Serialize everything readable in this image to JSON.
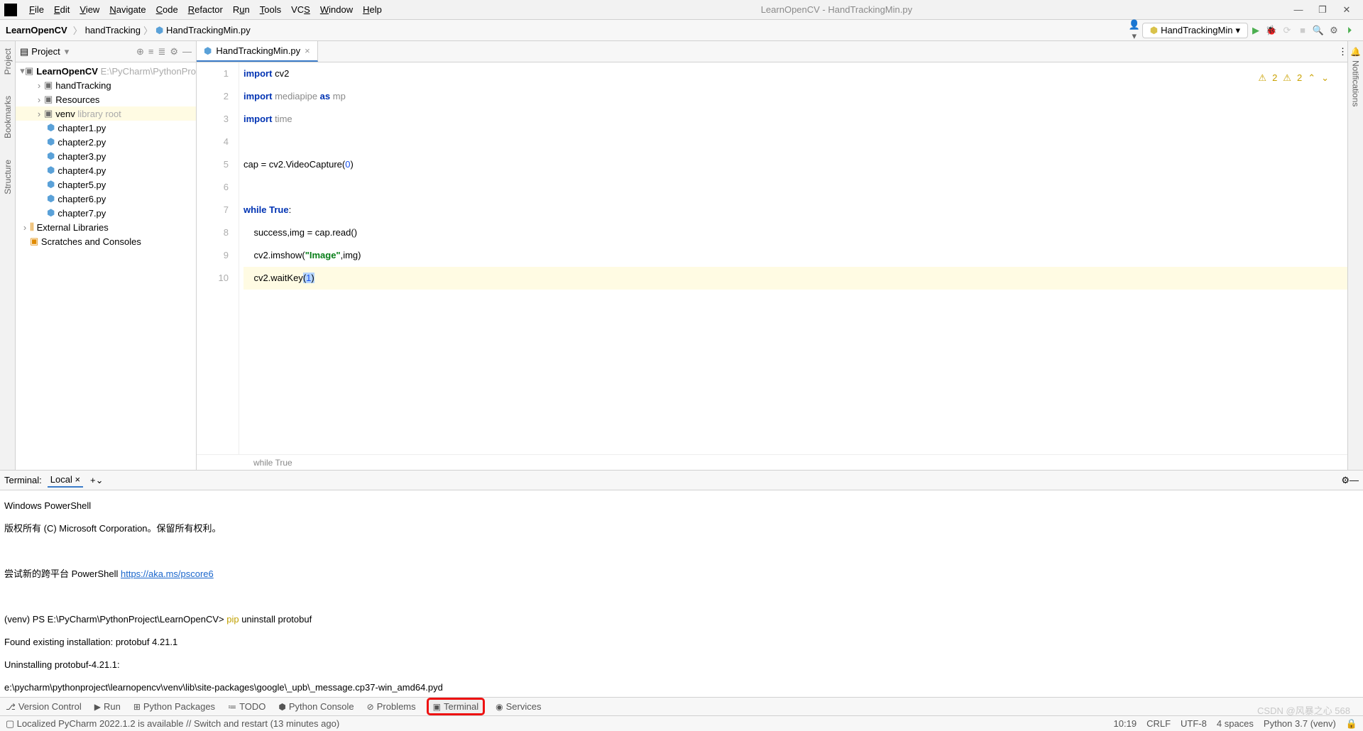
{
  "window": {
    "title": "LearnOpenCV - HandTrackingMin.py"
  },
  "menu": [
    "File",
    "Edit",
    "View",
    "Navigate",
    "Code",
    "Refactor",
    "Run",
    "Tools",
    "VCS",
    "Window",
    "Help"
  ],
  "breadcrumbs": [
    "LearnOpenCV",
    "handTracking",
    "HandTrackingMin.py"
  ],
  "runconfig": "HandTrackingMin",
  "project": {
    "label": "Project",
    "root": {
      "name": "LearnOpenCV",
      "path": "E:\\PyCharm\\PythonPro"
    },
    "folders": [
      {
        "name": "handTracking"
      },
      {
        "name": "Resources"
      },
      {
        "name": "venv",
        "hint": "library root",
        "sel": true
      }
    ],
    "files": [
      "chapter1.py",
      "chapter2.py",
      "chapter3.py",
      "chapter4.py",
      "chapter5.py",
      "chapter6.py",
      "chapter7.py"
    ],
    "extra": [
      "External Libraries",
      "Scratches and Consoles"
    ]
  },
  "tab": {
    "name": "HandTrackingMin.py"
  },
  "warnings": {
    "w1": "2",
    "w2": "2"
  },
  "code": {
    "lines": [
      {
        "n": "1",
        "seg": [
          {
            "t": "import ",
            "c": "kw"
          },
          {
            "t": "cv2"
          }
        ]
      },
      {
        "n": "2",
        "seg": [
          {
            "t": "import ",
            "c": "kw"
          },
          {
            "t": "mediapipe ",
            "c": "dimc"
          },
          {
            "t": "as ",
            "c": "kw"
          },
          {
            "t": "mp",
            "c": "dimc"
          }
        ]
      },
      {
        "n": "3",
        "seg": [
          {
            "t": "import ",
            "c": "kw"
          },
          {
            "t": "time",
            "c": "dimc"
          }
        ]
      },
      {
        "n": "4",
        "seg": []
      },
      {
        "n": "5",
        "seg": [
          {
            "t": "cap = cv2.VideoCapture("
          },
          {
            "t": "0",
            "c": "num"
          },
          {
            "t": ")"
          }
        ]
      },
      {
        "n": "6",
        "seg": []
      },
      {
        "n": "7",
        "seg": [
          {
            "t": "while True",
            "c": "kw"
          },
          {
            "t": ":"
          }
        ]
      },
      {
        "n": "8",
        "seg": [
          {
            "t": "    success,img = cap.read()"
          }
        ]
      },
      {
        "n": "9",
        "seg": [
          {
            "t": "    cv2.imshow("
          },
          {
            "t": "\"Image\"",
            "c": "str"
          },
          {
            "t": ",img)"
          }
        ]
      },
      {
        "n": "10",
        "seg": [
          {
            "t": "    cv2.waitKey"
          },
          {
            "t": "(",
            "c": "sel"
          },
          {
            "t": "1",
            "c": "numsel"
          },
          {
            "t": ")",
            "c": "sel"
          }
        ],
        "hl": true
      }
    ],
    "foot": "while True"
  },
  "terminal": {
    "label": "Terminal:",
    "tab": "Local",
    "lines": [
      "Windows PowerShell",
      "版权所有 (C) Microsoft Corporation。保留所有权利。",
      "",
      "尝试新的跨平台 PowerShell https://aka.ms/pscore6",
      "",
      "(venv) PS E:\\PyCharm\\PythonProject\\LearnOpenCV> pip uninstall protobuf",
      "Found existing installation: protobuf 4.21.1",
      "Uninstalling protobuf-4.21.1:",
      "    e:\\pycharm\\pythonproject\\learnopencv\\venv\\lib\\site-packages\\google\\_upb\\_message.cp37-win_amd64.pyd"
    ],
    "link": "https://aka.ms/pscore6"
  },
  "bottom": [
    "Version Control",
    "Run",
    "Python Packages",
    "TODO",
    "Python Console",
    "Problems",
    "Terminal",
    "Services"
  ],
  "status": {
    "msg": "Localized PyCharm 2022.1.2 is available // Switch and restart (13 minutes ago)",
    "pos": "10:19",
    "eol": "CRLF",
    "enc": "UTF-8",
    "indent": "4 spaces",
    "py": "Python 3.7 (venv)"
  },
  "watermark": "CSDN @风暴之心 568"
}
